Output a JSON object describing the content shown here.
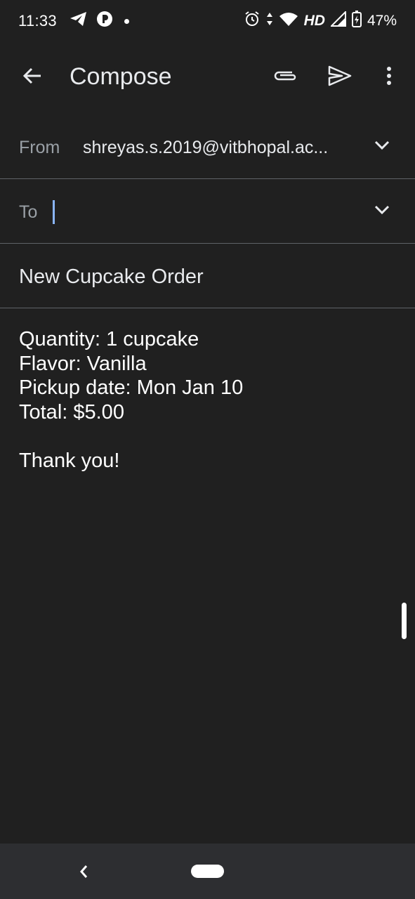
{
  "status_bar": {
    "time": "11:33",
    "network_label": "HD",
    "battery": "47%",
    "icons": [
      "telegram-icon",
      "app-icon",
      "notification-dot-icon",
      "alarm-icon",
      "data-arrows-icon",
      "wifi-icon",
      "signal-icon",
      "battery-charging-icon"
    ]
  },
  "app_bar": {
    "title": "Compose",
    "icons": [
      "back-arrow-icon",
      "attachment-icon",
      "send-icon",
      "more-vert-icon"
    ]
  },
  "compose": {
    "from_label": "From",
    "from_value": "shreyas.s.2019@vitbhopal.ac...",
    "to_label": "To",
    "to_value": "",
    "subject": "New Cupcake Order",
    "body": {
      "line1": "Quantity: 1 cupcake",
      "line2": "Flavor: Vanilla",
      "line3": "Pickup date: Mon Jan 10",
      "line4": "Total: $5.00",
      "line5": "Thank you!"
    }
  },
  "colors": {
    "background": "#202020",
    "nav_bar": "#2d2e31",
    "divider": "#5f6368",
    "label": "#9aa0a6",
    "cursor": "#8ab4f8"
  }
}
